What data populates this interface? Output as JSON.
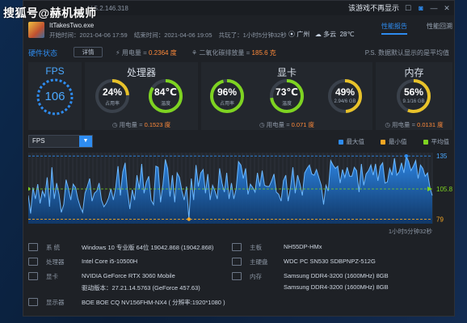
{
  "watermark": "搜狐号@赫机械师",
  "topbar": {
    "version": "V 5.2.146.318",
    "hide_game_label": "该游戏不再显示",
    "icons": [
      "camera-icon",
      "minimize-icon",
      "close-icon"
    ]
  },
  "game": {
    "name": "ItTakesTwo.exe",
    "start": "开始时间：2021-04-06 17:59",
    "end": "结束时间：2021-04-06 19:05",
    "duration": "共玩了：1小时5分钟32秒",
    "location": "广州",
    "weather": "多云",
    "temp": "28℃"
  },
  "tabs": [
    {
      "label": "性能报告",
      "active": true
    },
    {
      "label": "性能回溯",
      "active": false
    }
  ],
  "hw": {
    "title": "硬件状态",
    "detail": "详情",
    "power_label": "用电量 =",
    "power_value": "0.2364 度",
    "co2_label": "二氧化碳排放量 =",
    "co2_value": "185.6 克",
    "ps": "P.S. 数据默认显示的是平均值"
  },
  "fps": {
    "title": "FPS",
    "value": "106"
  },
  "cpu": {
    "title": "处理器",
    "usage": "24%",
    "usage_label": "占用率",
    "temp": "84℃",
    "temp_label": "温度",
    "power_label": "用电量 =",
    "power": "0.1523 度",
    "usage_frac": 0.24,
    "temp_frac": 0.84
  },
  "gpu": {
    "title": "显卡",
    "usage": "96%",
    "usage_label": "占用率",
    "temp": "73℃",
    "temp_label": "温度",
    "mem": "49%",
    "mem_label": "2.94/6 GB",
    "power_label": "用电量 =",
    "power": "0.071 度",
    "usage_frac": 0.96,
    "temp_frac": 0.73,
    "mem_frac": 0.49
  },
  "mem": {
    "title": "内存",
    "usage": "56%",
    "usage_label": "9.1/16 GB",
    "power_label": "用电量 =",
    "power": "0.0131 度",
    "usage_frac": 0.56
  },
  "colors": {
    "accent": "#2e8cf0",
    "green": "#7ed321",
    "yellow": "#e8c22a",
    "orange": "#ff8a3a",
    "max": "#2e8cf0",
    "min": "#f5a623",
    "avg": "#7ed321"
  },
  "chart_data": {
    "type": "area",
    "metric": "FPS",
    "series": [
      {
        "name": "最大值",
        "value": 135
      },
      {
        "name": "最小值",
        "value": 79
      },
      {
        "name": "平均值",
        "value": 105.81
      }
    ],
    "labels": {
      "max": "135",
      "avg": "105.81",
      "min": "79",
      "duration": "1小时5分钟32秒"
    },
    "values": [
      100,
      84,
      107,
      97,
      110,
      93,
      104,
      99,
      116,
      90,
      125,
      97,
      111,
      101,
      85,
      92,
      114,
      106,
      96,
      110,
      107,
      97,
      90,
      85,
      102,
      108,
      115,
      95,
      102,
      104,
      111,
      96,
      90,
      93,
      98,
      106,
      96,
      107,
      126,
      100,
      121,
      129,
      104,
      88,
      105,
      96,
      118,
      106,
      128,
      102,
      112,
      117,
      96,
      92,
      126,
      125,
      94,
      110,
      132,
      124,
      99,
      118,
      94,
      120,
      116,
      104,
      96,
      108,
      79,
      115,
      96,
      127,
      108,
      120,
      123,
      102,
      119,
      96,
      109,
      104,
      97,
      124,
      111,
      103,
      120,
      97,
      111,
      97,
      106,
      130,
      127,
      115,
      124,
      101,
      110,
      107,
      103,
      120,
      108,
      122,
      109,
      108,
      108,
      113,
      119,
      103,
      101,
      95,
      113,
      118,
      95,
      107,
      125,
      102,
      118,
      110,
      100,
      120,
      124,
      127,
      119,
      118,
      123,
      116,
      109,
      92,
      109,
      104,
      131,
      127,
      124,
      126,
      111,
      123,
      116,
      125,
      117,
      117,
      125,
      122,
      103,
      128,
      109,
      119,
      122,
      127,
      118,
      128,
      113,
      126,
      129,
      111,
      112,
      124,
      118,
      133,
      118,
      121,
      129,
      120,
      135,
      130,
      122,
      126,
      131,
      115,
      127,
      124,
      117,
      120,
      107,
      100
    ],
    "ylim": [
      75,
      138
    ]
  },
  "chart_ui": {
    "dropdown": "FPS",
    "legend": [
      "最大值",
      "最小值",
      "平均值"
    ]
  },
  "system": {
    "os_label": "系  统",
    "os": "Windows 10 专业版 64位   19042.868 (19042.868)",
    "cpu_label": "处理器",
    "cpu": "Intel Core i5-10500H",
    "gpu_label": "显卡",
    "gpu": "NVIDIA GeForce RTX 3060 Mobile",
    "driver": "驱动版本：27.21.14.5763 (GeForce 457.63)",
    "display_label": "显示器",
    "display": "BOE BOE CQ NV156FHM-NX4 ( 分辨率:1920*1080 )",
    "board_label": "主板",
    "board": "NH55DP-HMx",
    "disk_label": "主硬盘",
    "disk": "WDC PC SN530 SDBPNPZ-512G",
    "ram_label": "内存",
    "ram1": "Samsung DDR4-3200 (1600MHz) 8GB",
    "ram2": "Samsung DDR4-3200 (1600MHz) 8GB"
  }
}
